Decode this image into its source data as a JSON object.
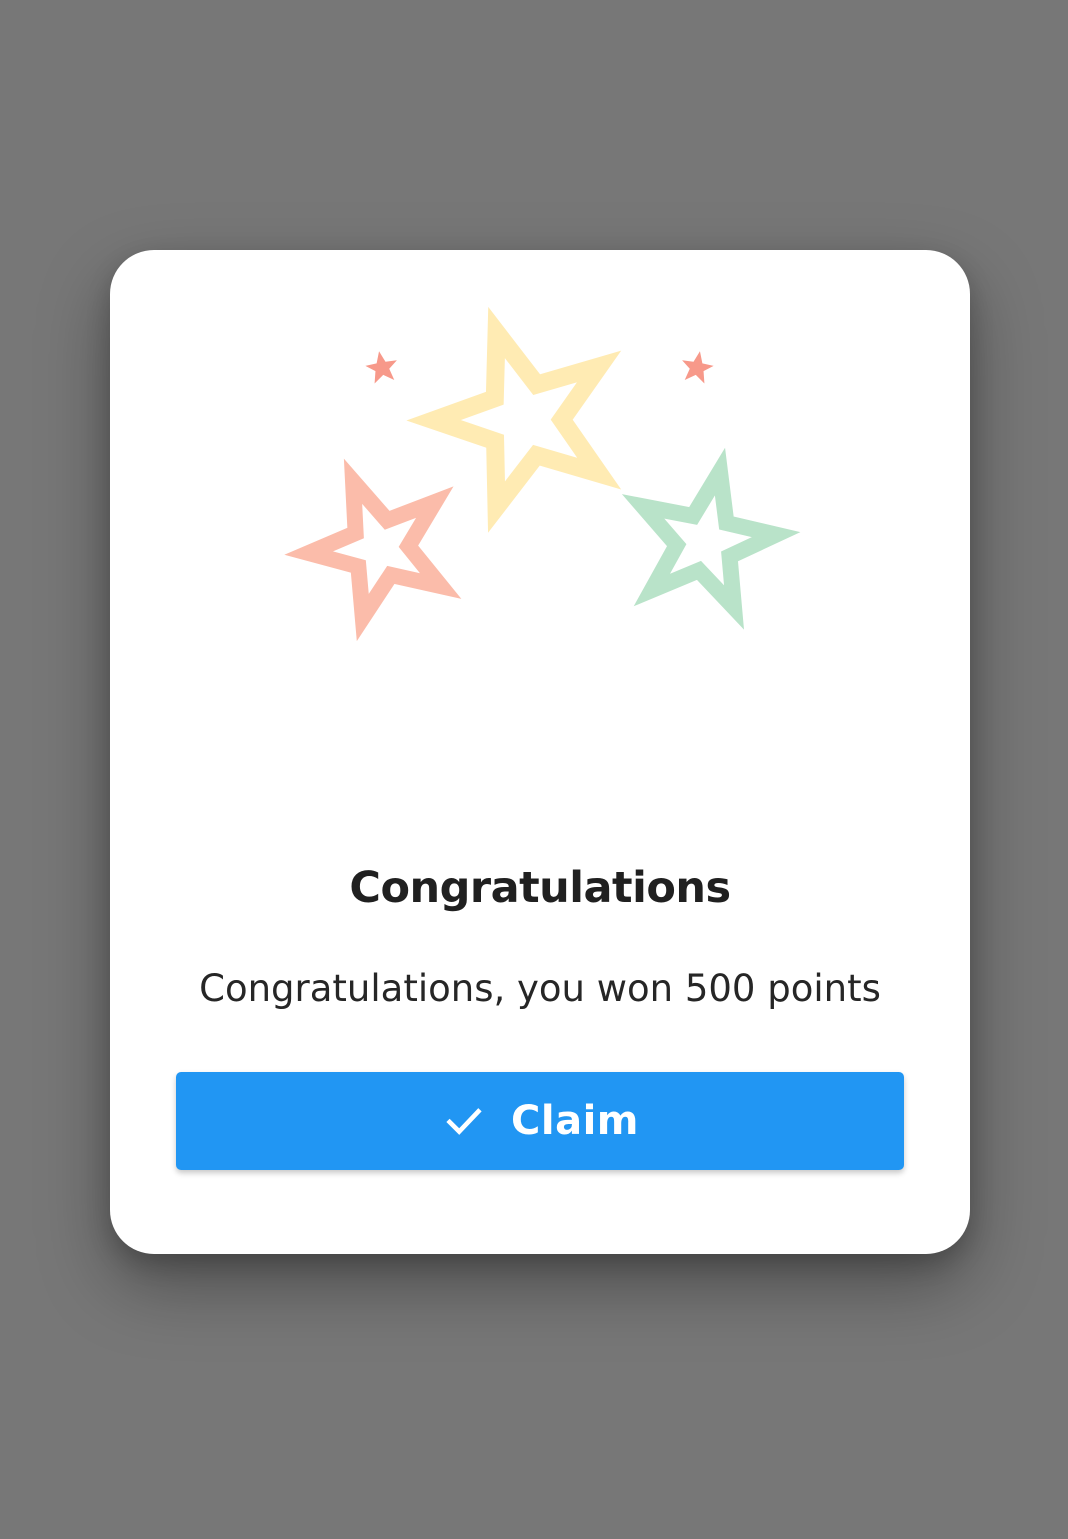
{
  "dialog": {
    "title": "Congratulations",
    "message": "Congratulations, you won 500 points",
    "claim_label": "Claim",
    "claim_icon": "check-icon",
    "illustration_icons": [
      "star-icon-yellow",
      "star-icon-red",
      "star-icon-green",
      "sparkle-icon-left",
      "sparkle-icon-right"
    ]
  },
  "colors": {
    "overlay": "#777777",
    "dialog_background": "#ffffff",
    "button": "#2196f3",
    "button_text": "#ffffff",
    "title_text": "#202020",
    "star_yellow": "#ffebb3",
    "star_red": "#fbbcaa",
    "star_green": "#b9e3c9",
    "sparkle": "#f7998a"
  }
}
